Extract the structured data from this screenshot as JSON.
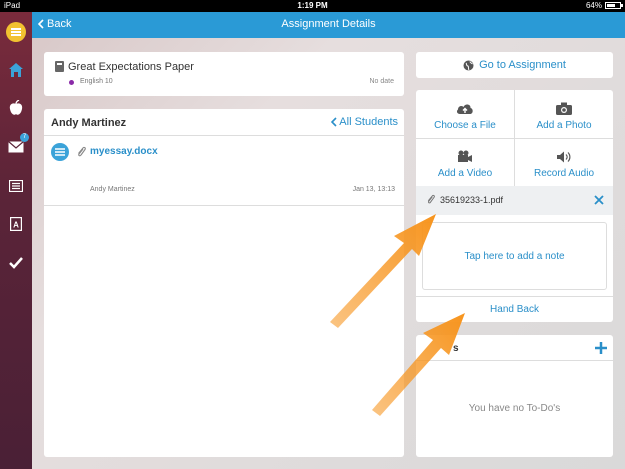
{
  "status_bar": {
    "device": "iPad",
    "time": "1:19 PM",
    "battery": "64%"
  },
  "nav": {
    "back_label": "Back",
    "title": "Assignment Details"
  },
  "sidebar": {
    "badge_count": "7",
    "items": [
      "logo-icon",
      "home-icon",
      "apple-icon",
      "mail-icon",
      "gradebook-icon",
      "assessment-icon",
      "check-icon"
    ]
  },
  "assignment": {
    "title": "Great Expectations Paper",
    "course": "English 10",
    "due": "No date"
  },
  "student": {
    "name": "Andy Martinez",
    "all_students_label": "All Students"
  },
  "submission": {
    "file_name": "myessay.docx",
    "submitted_by": "Andy Martinez",
    "date": "Jan 13, 13:13"
  },
  "goto_label": "Go to Assignment",
  "actions": {
    "choose_file": "Choose a File",
    "add_photo": "Add a Photo",
    "add_video": "Add a Video",
    "record_audio": "Record Audio"
  },
  "attachment": {
    "file_name": "35619233-1.pdf"
  },
  "note_placeholder": "Tap here to add a note",
  "hand_back_label": "Hand Back",
  "todo": {
    "title_visible": "s",
    "empty_message": "You have no To-Do's"
  },
  "colors": {
    "accent": "#2a9ad6",
    "link": "#2a8fc9",
    "arrow": "#f7941d",
    "sidebar": "#5b2438"
  }
}
